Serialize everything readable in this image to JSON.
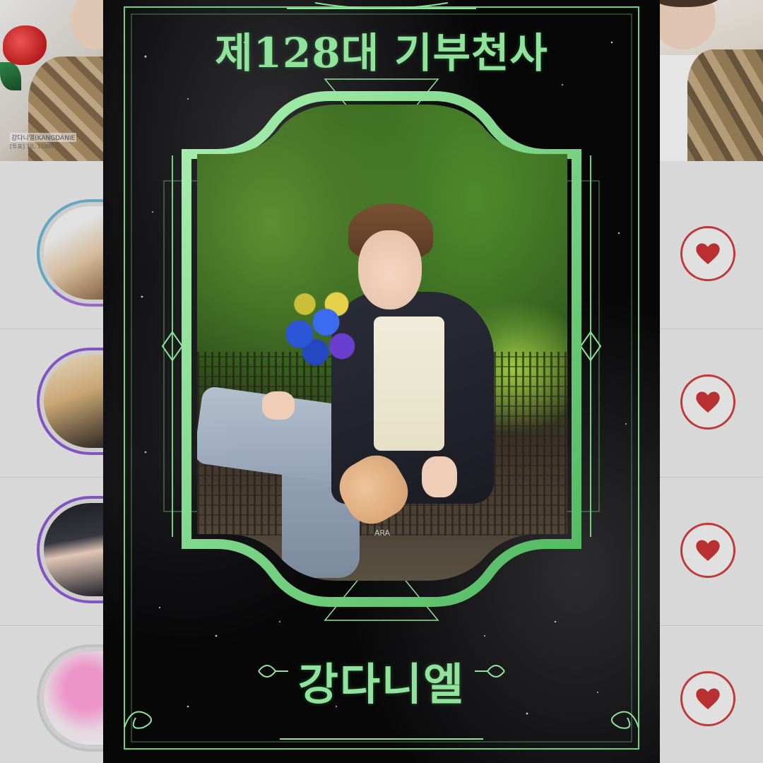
{
  "background_list": {
    "banner_left": {
      "caption_name": "강다니엘(KANGDANIE",
      "caption_meta": "[투표] 10, 10AM ~"
    },
    "rows": [
      {
        "avatar": "avatar-kangdaniel",
        "action_icon": "heart-icon"
      },
      {
        "avatar": "avatar-idol-2",
        "action_icon": "heart-icon"
      },
      {
        "avatar": "avatar-idol-3",
        "action_icon": "heart-icon"
      },
      {
        "avatar": "avatar-idol-4",
        "action_icon": "heart-icon"
      }
    ],
    "colors": {
      "heart": "#cf3b3b",
      "ring": "#8c5ad0"
    }
  },
  "poster": {
    "title": "제128대 기부천사",
    "name": "강다니엘",
    "photo_watermark": "ARA",
    "colors": {
      "accent": "#8fe39a",
      "frame": "#6fd17c",
      "background": "#070708"
    }
  }
}
